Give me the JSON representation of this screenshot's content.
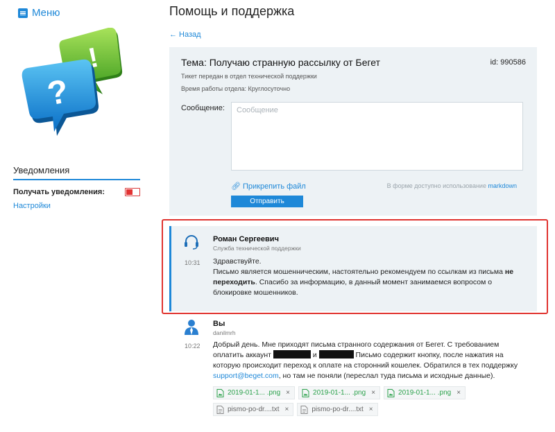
{
  "sidebar": {
    "menu_label": "Меню",
    "notifications_title": "Уведомления",
    "receive_notifications_label": "Получать уведомления:",
    "settings_link": "Настройки"
  },
  "header": {
    "title": "Помощь и поддержка",
    "back_link": "← Назад"
  },
  "ticket": {
    "subject": "Тема: Получаю странную рассылку от Бегет",
    "id": "id: 990586",
    "transfer_note": "Тикет передан в отдел технической поддержки",
    "hours_note": "Время работы отдела: Круглосуточно",
    "message_label": "Сообщение:",
    "message_placeholder": "Сообщение",
    "message_value": "",
    "attach_label": "Прикрепить файл",
    "markdown_prefix": "В форме доступно использование",
    "markdown_link": "markdown",
    "send_label": "Отправить"
  },
  "messages": [
    {
      "author": "Роман Сергеевич",
      "role": "Служба технической поддержки",
      "time": "10:31",
      "greeting": "Здравствуйте.",
      "text_1": "Письмо является мошенническим, настоятельно рекомендуем по ссылкам из письма",
      "text_bold": "не переходить",
      "text_2": ". Спасибо за информацию, в данный момент занимаемся вопросом о блокировке мошенников."
    },
    {
      "author": "Вы",
      "role": "danilmrh",
      "time": "10:22",
      "text_1": "Добрый день. Мне приходят письма странного содержания от Бегет. С требованием оплатить аккаунт",
      "text_and": "и",
      "text_2": "Письмо содержит кнопку, после нажатия на которую происходит переход к оплате на сторонний кошелек. Обратился в тех поддержку",
      "email": "support@beget.com",
      "text_3": ", но там не поняли (переслал туда письма и исходные данные).",
      "files": [
        {
          "name": "2019-01-1... .png",
          "kind": "png"
        },
        {
          "name": "2019-01-1... .png",
          "kind": "png"
        },
        {
          "name": "2019-01-1... .png",
          "kind": "png"
        },
        {
          "name": "pismo-po-dr....txt",
          "kind": "txt"
        },
        {
          "name": "pismo-po-dr....txt",
          "kind": "txt"
        }
      ],
      "remove_symbol": "×"
    }
  ],
  "colors": {
    "accent": "#1e88d8",
    "panel_bg": "#edf2f5",
    "highlight": "#e0332f",
    "toggle_off": "#e23333",
    "file_png": "#2ba14b"
  },
  "icons": [
    "menu-icon",
    "support-chat-illustration",
    "paperclip-icon",
    "headset-avatar-icon",
    "user-avatar-icon",
    "image-file-icon",
    "text-file-icon",
    "close-icon"
  ]
}
